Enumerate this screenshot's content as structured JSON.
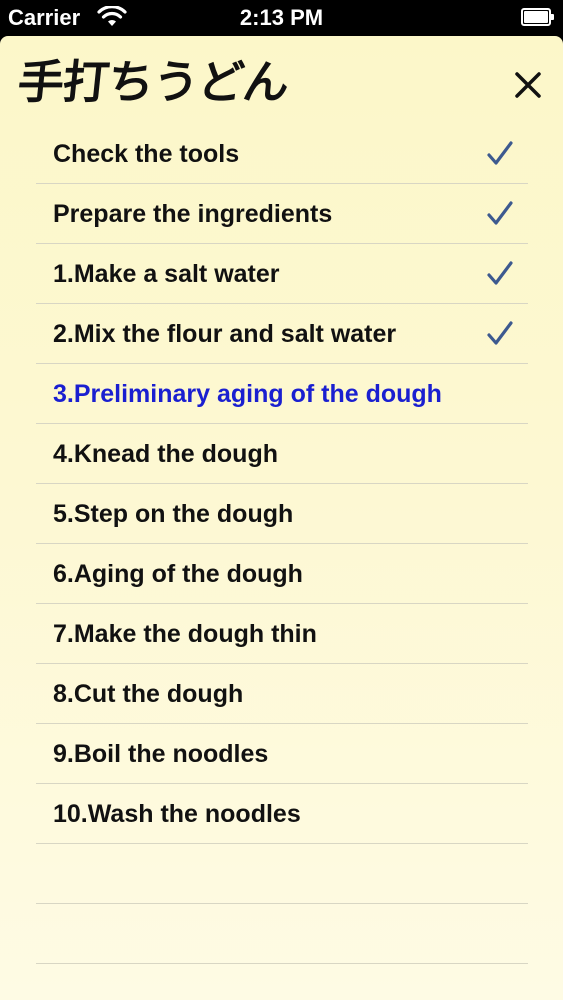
{
  "status_bar": {
    "carrier": "Carrier",
    "time": "2:13 PM"
  },
  "app": {
    "title": "手打ちうどん",
    "close_icon": "close-x-icon"
  },
  "steps": [
    {
      "label": "Check the tools",
      "completed": true
    },
    {
      "label": "Prepare the ingredients",
      "completed": true
    },
    {
      "label": "1.Make a salt water",
      "completed": true
    },
    {
      "label": "2.Mix the flour and salt water",
      "completed": true
    },
    {
      "label": "3.Preliminary aging of the dough",
      "completed": false,
      "current": true
    },
    {
      "label": "4.Knead the dough",
      "completed": false
    },
    {
      "label": "5.Step on the dough",
      "completed": false
    },
    {
      "label": "6.Aging of the dough",
      "completed": false
    },
    {
      "label": "7.Make the dough thin",
      "completed": false
    },
    {
      "label": "8.Cut the dough",
      "completed": false
    },
    {
      "label": "9.Boil the noodles",
      "completed": false
    },
    {
      "label": "10.Wash the noodles",
      "completed": false
    }
  ],
  "colors": {
    "current_step": "#1a1fd0",
    "checkmark": "#3d5a8f",
    "background": "#fcf7c9"
  }
}
